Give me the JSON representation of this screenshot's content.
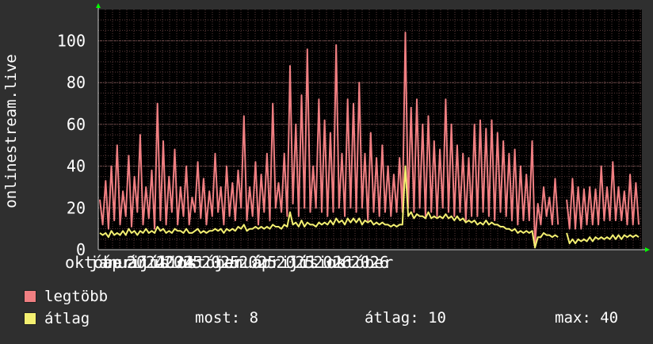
{
  "chart_data": {
    "type": "line",
    "ylabel": "onlinestream.live",
    "ylim": [
      0,
      115
    ],
    "y_ticks": [
      0,
      20,
      40,
      60,
      80,
      100
    ],
    "x_tick_labels": [
      "október",
      "január 2024",
      "április",
      "2024",
      "július",
      "2025",
      "október",
      "2025",
      "január",
      "2025",
      "április",
      "2025",
      "július",
      "2026",
      "október",
      "2026"
    ],
    "grid": true,
    "legend_placement": "bottom-left",
    "colors": {
      "max": "#f07f82",
      "avg": "#f4f071",
      "background": "#2f2f2f",
      "plot_bg": "#000000",
      "grid": "#8a6060",
      "axis_arrow": "#00ff00"
    },
    "series": [
      {
        "name": "legtöbb",
        "values": [
          24,
          12,
          33,
          10,
          40,
          14,
          50,
          12,
          28,
          16,
          45,
          11,
          35,
          18,
          55,
          12,
          30,
          15,
          38,
          10,
          70,
          14,
          52,
          12,
          35,
          18,
          48,
          12,
          30,
          16,
          40,
          12,
          25,
          18,
          42,
          15,
          34,
          12,
          28,
          16,
          46,
          18,
          30,
          12,
          40,
          16,
          32,
          14,
          38,
          20,
          64,
          14,
          30,
          16,
          42,
          12,
          36,
          18,
          46,
          14,
          70,
          20,
          32,
          18,
          46,
          16,
          88,
          22,
          60,
          16,
          74,
          20,
          96,
          18,
          40,
          20,
          72,
          18,
          62,
          16,
          56,
          18,
          98,
          20,
          46,
          16,
          72,
          20,
          70,
          18,
          80,
          20,
          46,
          14,
          56,
          18,
          44,
          16,
          50,
          18,
          40,
          16,
          36,
          18,
          44,
          18,
          104,
          20,
          68,
          18,
          72,
          20,
          60,
          16,
          64,
          18,
          52,
          16,
          48,
          20,
          72,
          18,
          60,
          16,
          50,
          18,
          46,
          14,
          44,
          16,
          60,
          16,
          62,
          18,
          58,
          16,
          62,
          14,
          56,
          18,
          52,
          16,
          46,
          14,
          48,
          12,
          40,
          14,
          36,
          14,
          52,
          2,
          22,
          12,
          30,
          16,
          25,
          12,
          34,
          12,
          null,
          null,
          24,
          10,
          34,
          10,
          30,
          10,
          29,
          12,
          30,
          12,
          29,
          12,
          40,
          14,
          30,
          14,
          42,
          14,
          30,
          14,
          28,
          12,
          36,
          12,
          32,
          12
        ],
        "gaps": "short break around the beginning of 2026"
      },
      {
        "name": "átlag",
        "values": [
          8,
          7,
          8,
          6,
          9,
          7,
          8,
          7,
          9,
          7,
          10,
          8,
          9,
          7,
          9,
          8,
          10,
          8,
          9,
          8,
          11,
          9,
          10,
          8,
          9,
          8,
          10,
          9,
          9,
          8,
          10,
          8,
          8,
          9,
          10,
          8,
          9,
          8,
          9,
          9,
          10,
          9,
          10,
          8,
          10,
          9,
          10,
          9,
          11,
          10,
          12,
          9,
          10,
          10,
          11,
          10,
          11,
          10,
          11,
          10,
          12,
          11,
          11,
          10,
          12,
          11,
          18,
          12,
          13,
          11,
          14,
          11,
          13,
          12,
          12,
          11,
          13,
          12,
          13,
          12,
          14,
          12,
          15,
          13,
          14,
          12,
          15,
          13,
          15,
          13,
          15,
          12,
          14,
          13,
          14,
          12,
          13,
          12,
          13,
          12,
          12,
          11,
          12,
          11,
          12,
          12,
          40,
          16,
          18,
          15,
          17,
          16,
          16,
          15,
          18,
          15,
          16,
          15,
          16,
          15,
          17,
          15,
          16,
          14,
          16,
          14,
          15,
          13,
          14,
          13,
          14,
          12,
          13,
          12,
          14,
          12,
          13,
          12,
          12,
          11,
          11,
          10,
          10,
          9,
          10,
          8,
          9,
          8,
          9,
          8,
          9,
          1,
          6,
          6,
          8,
          7,
          7,
          6,
          7,
          6,
          null,
          null,
          8,
          3,
          5,
          3,
          5,
          4,
          5,
          4,
          6,
          4,
          6,
          5,
          6,
          5,
          6,
          5,
          7,
          5,
          7,
          5,
          7,
          6,
          7,
          6,
          7,
          6
        ]
      }
    ]
  },
  "legend": [
    {
      "label": "legtöbb",
      "color": "#f07f82"
    },
    {
      "label": "átlag",
      "color": "#f4f071"
    }
  ],
  "stats": {
    "now": "most: 8",
    "avg": "átlag: 10",
    "max": "max: 40"
  }
}
